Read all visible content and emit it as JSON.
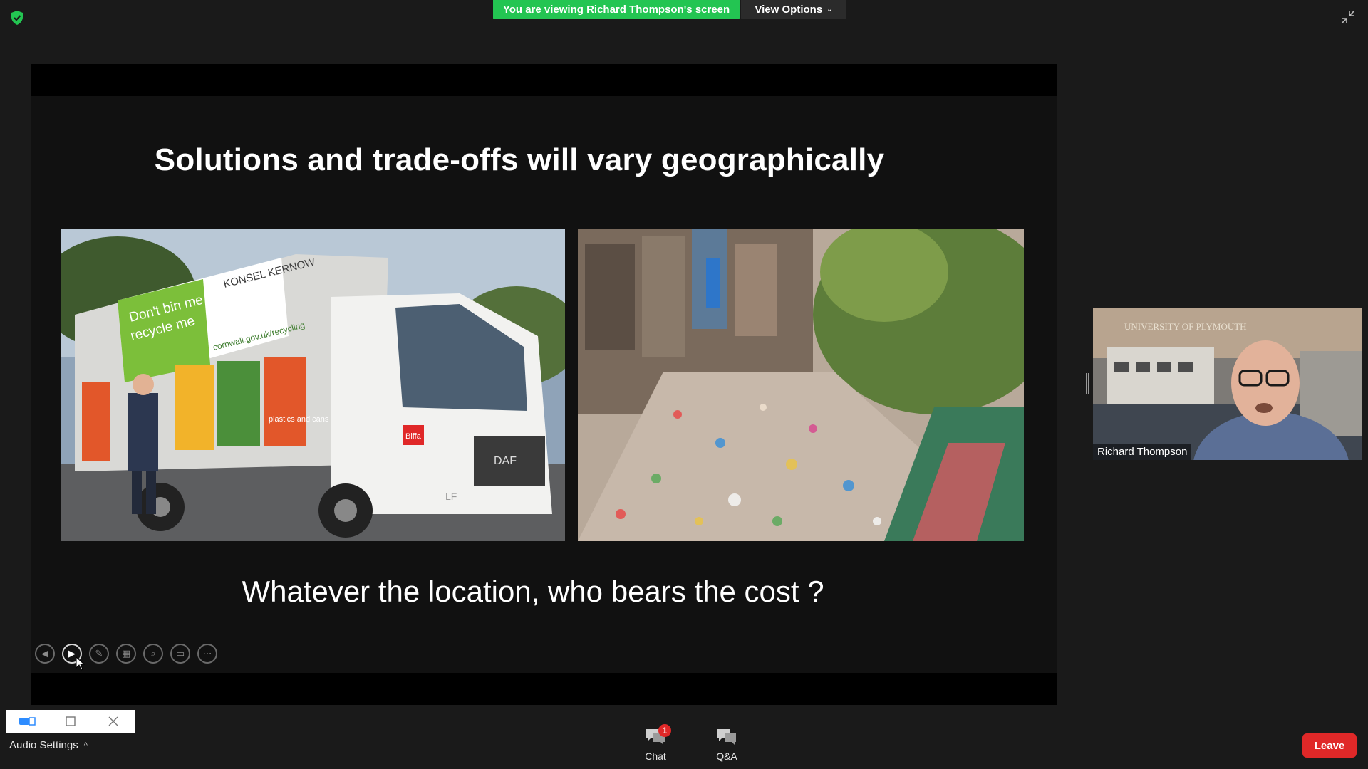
{
  "banner": {
    "viewing_text": "You are viewing Richard Thompson's screen",
    "view_options_label": "View Options"
  },
  "slide": {
    "title": "Solutions and trade-offs will vary geographically",
    "subtitle": "Whatever the location, who bears the cost ?",
    "truck_sign_line1": "Don't bin me",
    "truck_sign_line2": "recycle me",
    "truck_brand": "KONSEL KERNOW",
    "truck_web": "cornwall.gov.uk/recycling",
    "truck_side_label": "plastics and cans",
    "truck_logo": "Biffa",
    "truck_grille": "DAF",
    "truck_model": "LF"
  },
  "slide_controls": [
    {
      "name": "previous-slide-button",
      "glyph": "◀"
    },
    {
      "name": "next-slide-button",
      "glyph": "▶"
    },
    {
      "name": "pen-tool-button",
      "glyph": "✎"
    },
    {
      "name": "see-all-slides-button",
      "glyph": "▦"
    },
    {
      "name": "zoom-button",
      "glyph": "⌕"
    },
    {
      "name": "subtitles-button",
      "glyph": "▭"
    },
    {
      "name": "more-options-button",
      "glyph": "⋯"
    }
  ],
  "video": {
    "participant_name": "Richard Thompson",
    "background_sign": "UNIVERSITY OF PLYMOUTH"
  },
  "bottom": {
    "audio_settings_label": "Audio Settings",
    "chat_label": "Chat",
    "chat_badge": "1",
    "qa_label": "Q&A",
    "leave_label": "Leave"
  },
  "colors": {
    "banner_green": "#23c552",
    "leave_red": "#e02828",
    "background": "#1a1a1a"
  }
}
